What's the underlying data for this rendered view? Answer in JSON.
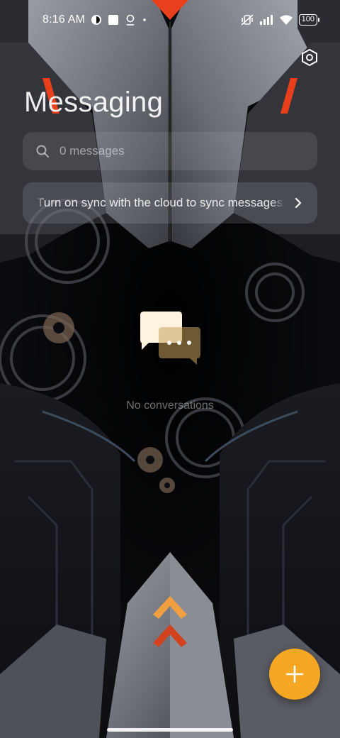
{
  "status_bar": {
    "time": "8:16 AM",
    "battery": "100",
    "icons": [
      "media-icon",
      "notification-square-icon",
      "location-pin-icon",
      "dot-icon",
      "mute-vibrate-icon",
      "signal-icon",
      "wifi-icon",
      "battery-icon"
    ]
  },
  "header": {
    "title": "Messaging",
    "settings_icon": "settings-hexagon-icon"
  },
  "search": {
    "placeholder": "0 messages",
    "icon": "search-icon"
  },
  "sync_banner": {
    "text": "Turn on sync with the cloud to sync messages",
    "icon": "chevron-right-icon"
  },
  "empty_state": {
    "text": "No conversations",
    "icon": "chat-bubbles-icon"
  },
  "fab": {
    "icon": "plus-icon",
    "color": "#f5a623"
  },
  "colors": {
    "accent": "#f5a623",
    "wallpaper_red": "#e8401c"
  }
}
